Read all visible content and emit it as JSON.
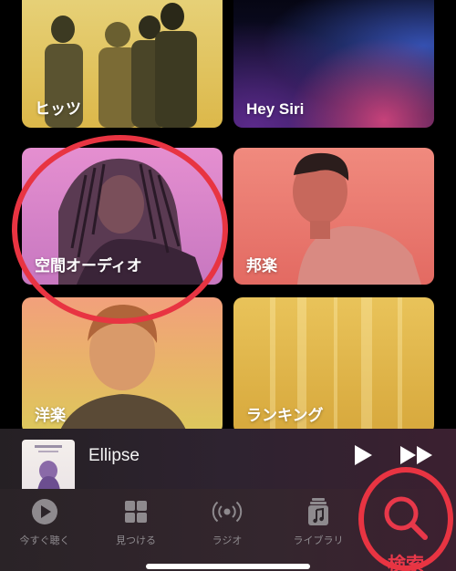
{
  "browse": {
    "tiles": [
      {
        "label": "ヒッツ"
      },
      {
        "label": "Hey Siri"
      },
      {
        "label": "空間オーディオ"
      },
      {
        "label": "邦楽"
      },
      {
        "label": "洋楽"
      },
      {
        "label": "ランキング"
      }
    ]
  },
  "now_playing": {
    "title": "Ellipse",
    "play_icon": "play-icon",
    "forward_icon": "forward-icon"
  },
  "tabs": [
    {
      "label": "今すぐ聴く",
      "icon": "play-circle-icon"
    },
    {
      "label": "見つける",
      "icon": "grid-icon"
    },
    {
      "label": "ラジオ",
      "icon": "radio-icon"
    },
    {
      "label": "ライブラリ",
      "icon": "library-icon"
    },
    {
      "label": "検索",
      "icon": "search-icon"
    }
  ],
  "colors": {
    "accent": "#e8384a",
    "annotation_ring": "#e83442",
    "tab_inactive": "#8e8a8e"
  }
}
